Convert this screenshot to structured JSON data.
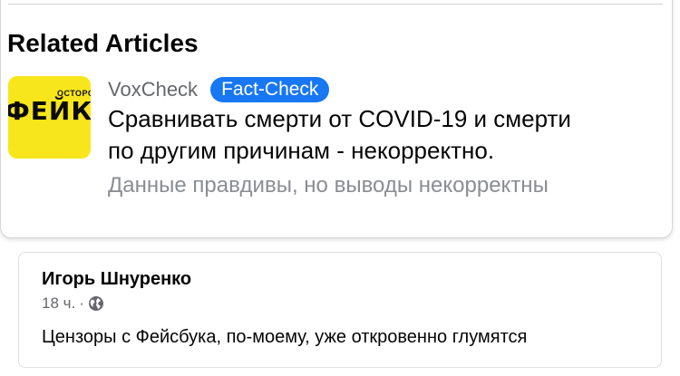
{
  "related": {
    "title": "Related Articles",
    "article": {
      "thumbnail": {
        "small_text": "ОСТОРОЖ",
        "big_text": "ФЕЙКИ",
        "background": "#f8e61c"
      },
      "source": "VoxCheck",
      "badge": "Fact-Check",
      "headline_line1": "Сравнивать смерти от COVID-19 и смерти",
      "headline_line2": "по другим причинам - некорректно.",
      "verdict": "Данные правдивы, но выводы некорректны"
    }
  },
  "post": {
    "author": "Игорь Шнуренко",
    "time": "18 ч.",
    "separator": "·",
    "privacy_icon": "globe-icon",
    "text": "Цензоры с Фейсбука, по-моему, уже откровенно глумятся"
  },
  "colors": {
    "accent": "#1877f2",
    "secondary_text": "#65676b",
    "muted_text": "#8a8d91",
    "primary_text": "#050505"
  }
}
